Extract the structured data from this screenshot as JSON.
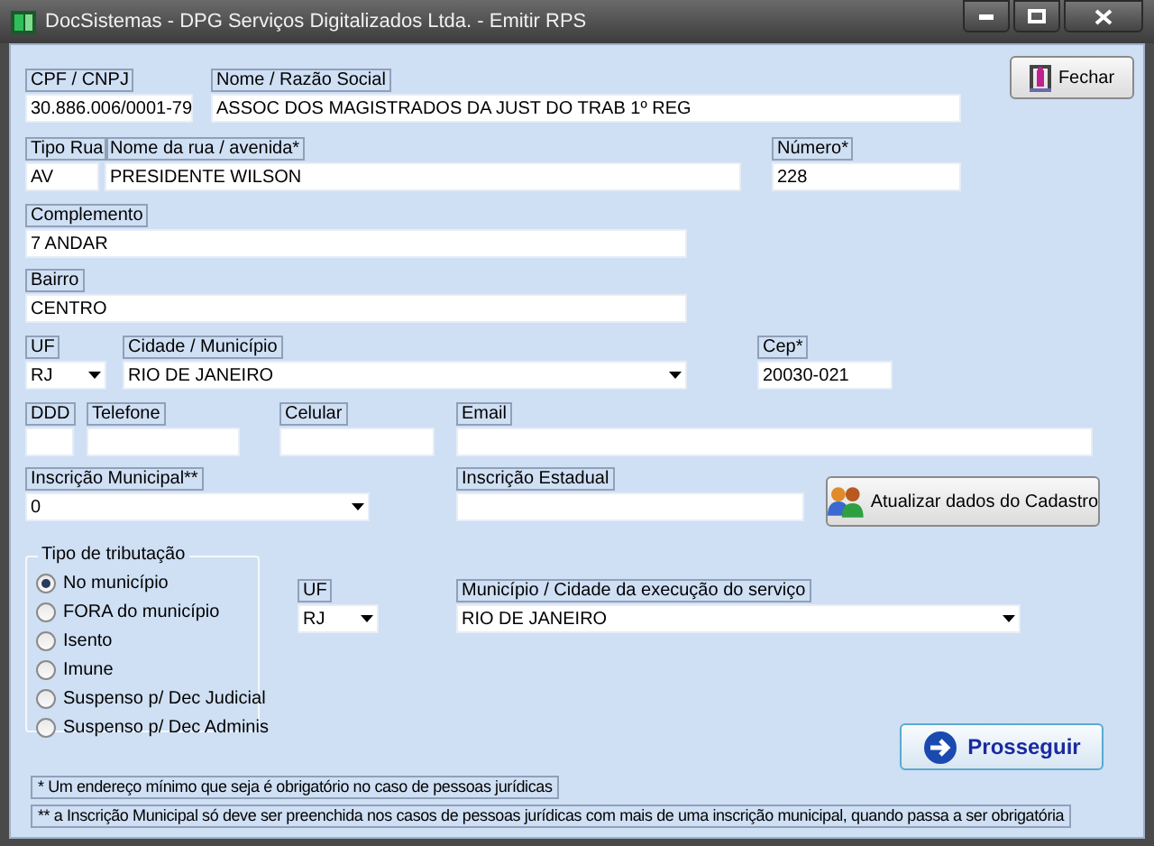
{
  "window": {
    "title": "DocSistemas - DPG Serviços Digitalizados Ltda. - Emitir RPS"
  },
  "close_button": {
    "label": "Fechar"
  },
  "fields": [
    {
      "label": "CPF / CNPJ",
      "value": "30.886.006/0001-79",
      "kind": "text"
    },
    {
      "label": "Nome / Razão Social",
      "value": "ASSOC DOS MAGISTRADOS DA JUST DO TRAB 1º REG",
      "kind": "text"
    },
    {
      "label": "Tipo Rua",
      "value": "AV",
      "kind": "text"
    },
    {
      "label": "Nome da rua / avenida*",
      "value": "PRESIDENTE WILSON",
      "kind": "text"
    },
    {
      "label": "Número*",
      "value": "228",
      "kind": "text"
    },
    {
      "label": "Complemento",
      "value": "7 ANDAR",
      "kind": "text"
    },
    {
      "label": "Bairro",
      "value": "CENTRO",
      "kind": "text"
    },
    {
      "label": "UF",
      "value": "RJ",
      "kind": "select"
    },
    {
      "label": "Cidade / Município",
      "value": "RIO DE JANEIRO",
      "kind": "select"
    },
    {
      "label": "Cep*",
      "value": "20030-021",
      "kind": "text"
    },
    {
      "label": "DDD",
      "kind": "text"
    },
    {
      "label": "Telefone",
      "kind": "text"
    },
    {
      "label": "Celular",
      "kind": "text"
    },
    {
      "label": "Email",
      "kind": "text"
    },
    {
      "label": "Inscrição Municipal**",
      "value": "0",
      "kind": "select"
    },
    {
      "label": "Inscrição Estadual",
      "kind": "text"
    }
  ],
  "update_button": {
    "label": "Atualizar dados do Cadastro"
  },
  "tributacao": {
    "title": "Tipo de tributação",
    "options": [
      {
        "label": "No município",
        "selected": true
      },
      {
        "label": "FORA do município",
        "selected": false
      },
      {
        "label": "Isento",
        "selected": false
      },
      {
        "label": "Imune",
        "selected": false
      },
      {
        "label": "Suspenso p/ Dec Judicial",
        "selected": false
      },
      {
        "label": "Suspenso p/ Dec Adminis",
        "selected": false
      }
    ]
  },
  "service_location": [
    {
      "label": "UF",
      "value": "RJ",
      "kind": "select"
    },
    {
      "label": "Município / Cidade da execução do serviço",
      "value": "RIO DE JANEIRO",
      "kind": "select"
    }
  ],
  "proceed_button": {
    "label": "Prosseguir"
  },
  "notes": [
    "* Um endereço mínimo que seja é obrigatório no caso de pessoas jurídicas",
    "** a Inscrição Municipal só deve ser preenchida nos casos de pessoas jurídicas com mais de uma inscrição municipal, quando passa a ser obrigatória"
  ]
}
